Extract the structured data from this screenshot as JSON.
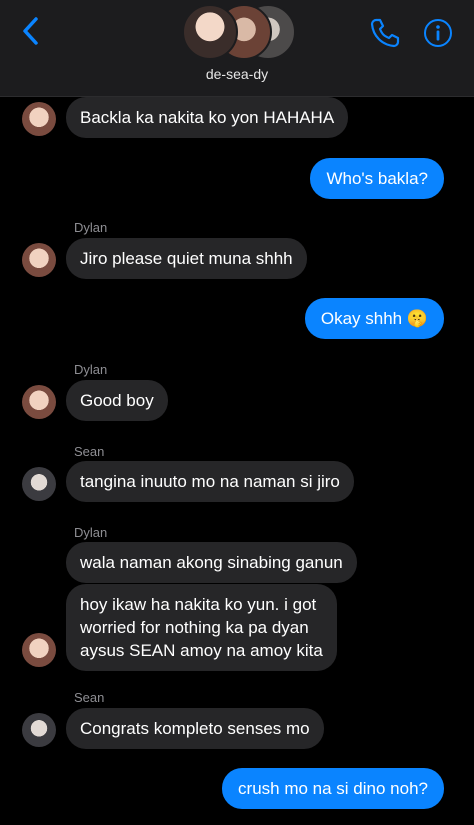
{
  "header": {
    "group_name": "de-sea-dy",
    "colors": {
      "background": "#1c1c1e",
      "accent": "#0a84ff"
    },
    "icons": [
      "chevron-left-icon",
      "phone-icon",
      "info-icon"
    ]
  },
  "colors": {
    "incoming_bubble": "#262628",
    "outgoing_bubble": "#0a84ff"
  },
  "messages": [
    {
      "text": "Backla ka nakita ko yon HAHAHA"
    },
    {
      "text": "Who's bakla?"
    },
    {
      "sender": "Dylan",
      "text": "Jiro please quiet muna shhh"
    },
    {
      "text": "Okay shhh 🤫"
    },
    {
      "sender": "Dylan",
      "text": "Good boy"
    },
    {
      "sender": "Sean",
      "text": "tangina inuuto mo na naman si jiro"
    },
    {
      "sender": "Dylan",
      "text": "wala naman akong sinabing ganun"
    },
    {
      "text": "hoy ikaw ha nakita ko yun. i got\nworried for nothing ka pa dyan\naysus SEAN amoy na amoy kita"
    },
    {
      "sender": "Sean",
      "text": "Congrats kompleto senses mo"
    },
    {
      "text": "crush mo na si dino noh?"
    }
  ]
}
